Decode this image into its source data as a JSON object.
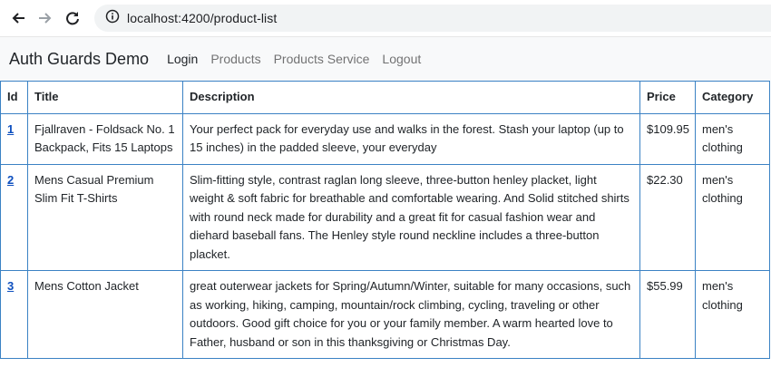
{
  "browser": {
    "url": "localhost:4200/product-list"
  },
  "navbar": {
    "brand": "Auth Guards Demo",
    "links": [
      {
        "label": "Login",
        "active": true
      },
      {
        "label": "Products",
        "active": false
      },
      {
        "label": "Products Service",
        "active": false
      },
      {
        "label": "Logout",
        "active": false
      }
    ]
  },
  "table": {
    "headers": [
      "Id",
      "Title",
      "Description",
      "Price",
      "Category"
    ],
    "rows": [
      {
        "id": "1",
        "title": "Fjallraven - Foldsack No. 1 Backpack, Fits 15 Laptops",
        "description": "Your perfect pack for everyday use and walks in the forest. Stash your laptop (up to 15 inches) in the padded sleeve, your everyday",
        "price": "$109.95",
        "category": "men's clothing"
      },
      {
        "id": "2",
        "title": "Mens Casual Premium Slim Fit T-Shirts",
        "description": "Slim-fitting style, contrast raglan long sleeve, three-button henley placket, light weight & soft fabric for breathable and comfortable wearing. And Solid stitched shirts with round neck made for durability and a great fit for casual fashion wear and diehard baseball fans. The Henley style round neckline includes a three-button placket.",
        "price": "$22.30",
        "category": "men's clothing"
      },
      {
        "id": "3",
        "title": "Mens Cotton Jacket",
        "description": "great outerwear jackets for Spring/Autumn/Winter, suitable for many occasions, such as working, hiking, camping, mountain/rock climbing, cycling, traveling or other outdoors. Good gift choice for you or your family member. A warm hearted love to Father, husband or son in this thanksgiving or Christmas Day.",
        "price": "$55.99",
        "category": "men's clothing"
      }
    ]
  }
}
